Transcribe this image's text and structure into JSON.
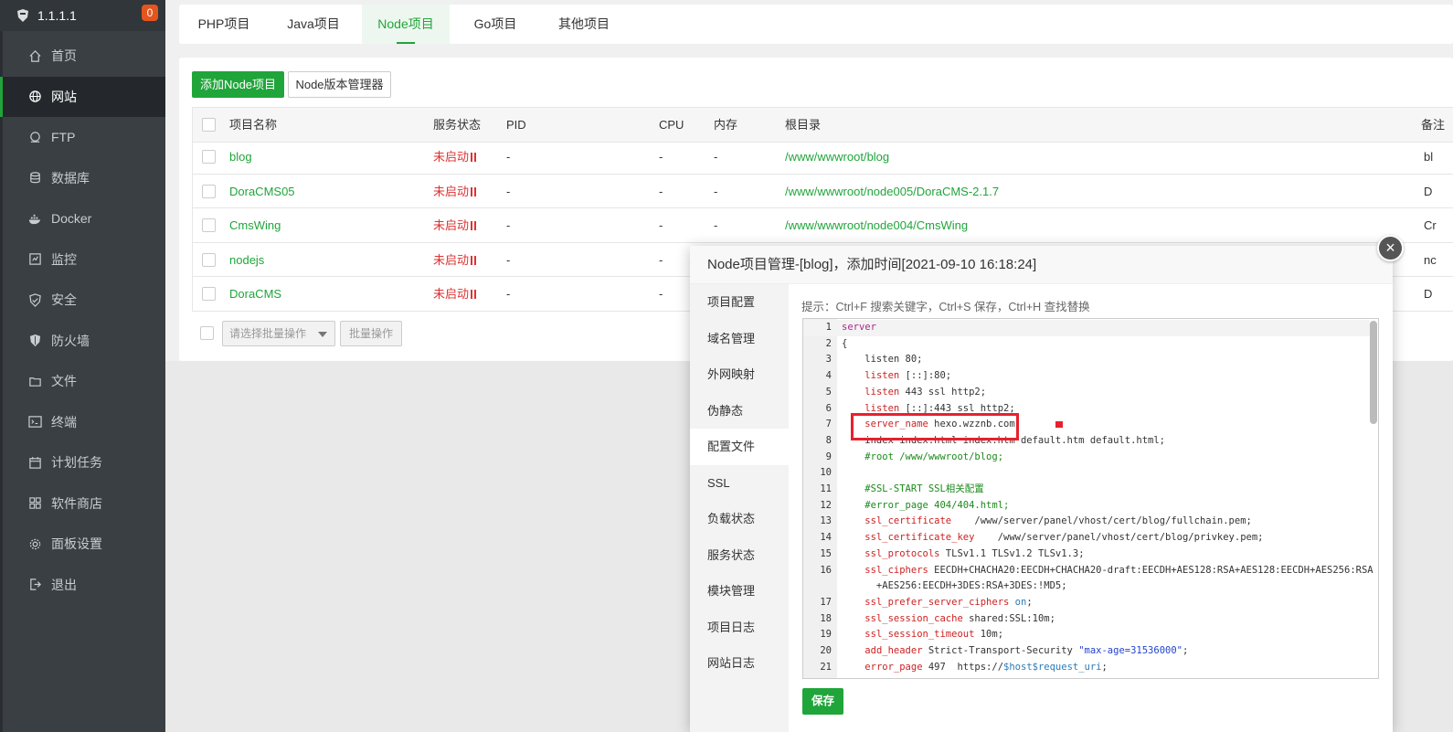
{
  "sidebar": {
    "ip": "1.1.1.1",
    "badge": "0",
    "items": [
      {
        "label": "首页",
        "icon": "home-icon"
      },
      {
        "label": "网站",
        "icon": "globe-icon",
        "active": true
      },
      {
        "label": "FTP",
        "icon": "ftp-icon"
      },
      {
        "label": "数据库",
        "icon": "database-icon"
      },
      {
        "label": "Docker",
        "icon": "docker-icon"
      },
      {
        "label": "监控",
        "icon": "monitor-icon"
      },
      {
        "label": "安全",
        "icon": "shield-check-icon"
      },
      {
        "label": "防火墙",
        "icon": "firewall-icon"
      },
      {
        "label": "文件",
        "icon": "folder-icon"
      },
      {
        "label": "终端",
        "icon": "terminal-icon"
      },
      {
        "label": "计划任务",
        "icon": "calendar-icon"
      },
      {
        "label": "软件商店",
        "icon": "apps-icon"
      },
      {
        "label": "面板设置",
        "icon": "gear-icon"
      },
      {
        "label": "退出",
        "icon": "logout-icon"
      }
    ]
  },
  "tabs": [
    "PHP项目",
    "Java项目",
    "Node项目",
    "Go项目",
    "其他项目"
  ],
  "toolbar": {
    "add_label": "添加Node项目",
    "version_label": "Node版本管理器"
  },
  "table": {
    "headers": [
      "项目名称",
      "服务状态",
      "PID",
      "CPU",
      "内存",
      "根目录",
      "备注"
    ],
    "rows": [
      {
        "name": "blog",
        "status": "未启动",
        "pid": "-",
        "cpu": "-",
        "mem": "-",
        "root": "/www/wwwroot/blog",
        "note": "bl"
      },
      {
        "name": "DoraCMS05",
        "status": "未启动",
        "pid": "-",
        "cpu": "-",
        "mem": "-",
        "root": "/www/wwwroot/node005/DoraCMS-2.1.7",
        "note": "D"
      },
      {
        "name": "CmsWing",
        "status": "未启动",
        "pid": "-",
        "cpu": "-",
        "mem": "-",
        "root": "/www/wwwroot/node004/CmsWing",
        "note": "Cr"
      },
      {
        "name": "nodejs",
        "status": "未启动",
        "pid": "-",
        "cpu": "-",
        "mem": "",
        "root": "",
        "note": "nc"
      },
      {
        "name": "DoraCMS",
        "status": "未启动",
        "pid": "-",
        "cpu": "-",
        "mem": "",
        "root": "",
        "note": "D"
      }
    ]
  },
  "bulk": {
    "select_placeholder": "请选择批量操作",
    "button": "批量操作"
  },
  "modal": {
    "title": "Node项目管理-[blog]，添加时间[2021-09-10 16:18:24]",
    "menu": [
      "项目配置",
      "域名管理",
      "外网映射",
      "伪静态",
      "配置文件",
      "SSL",
      "负载状态",
      "服务状态",
      "模块管理",
      "项目日志",
      "网站日志"
    ],
    "active_menu": "配置文件",
    "hint": "提示：Ctrl+F 搜索关键字，Ctrl+S 保存，Ctrl+H 查找替换",
    "save_label": "保存",
    "close_symbol": "×"
  },
  "code_lines": [
    {
      "n": "1",
      "html": "<span class='kw'>server</span>"
    },
    {
      "n": "2",
      "html": "{"
    },
    {
      "n": "3",
      "html": "    listen 80;"
    },
    {
      "n": "4",
      "html": "    <span class='dir'>listen</span> [::]:80;"
    },
    {
      "n": "5",
      "html": "    <span class='dir'>listen</span> 443 ssl http2;"
    },
    {
      "n": "6",
      "html": "    <span class='dir'>listen</span> [::]:443 ssl http2;"
    },
    {
      "n": "7",
      "html": "    <span class='dir'>server_name</span> hexo.wzznb.com;"
    },
    {
      "n": "8",
      "html": "    index index.html index.htm default.htm default.html;"
    },
    {
      "n": "9",
      "html": "    <span class='cmt'>#root /www/wwwroot/blog;</span>"
    },
    {
      "n": "10",
      "html": ""
    },
    {
      "n": "11",
      "html": "    <span class='cmt'>#SSL-START SSL相关配置</span>"
    },
    {
      "n": "12",
      "html": "    <span class='cmt'>#error_page 404/404.html;</span>"
    },
    {
      "n": "13",
      "html": "    <span class='dir'>ssl_certificate</span>    /www/server/panel/vhost/cert/blog/fullchain.pem;"
    },
    {
      "n": "14",
      "html": "    <span class='dir'>ssl_certificate_key</span>    /www/server/panel/vhost/cert/blog/privkey.pem;"
    },
    {
      "n": "15",
      "html": "    <span class='dir'>ssl_protocols</span> TLSv1.1 TLSv1.2 TLSv1.3;"
    },
    {
      "n": "16",
      "html": "    <span class='dir'>ssl_ciphers</span> EECDH+CHACHA20:EECDH+CHACHA20-draft:EECDH+AES128:RSA+AES128:EECDH+AES256:RSA"
    },
    {
      "n": "",
      "html": "      +AES256:EECDH+3DES:RSA+3DES:!MD5;"
    },
    {
      "n": "17",
      "html": "    <span class='dir'>ssl_prefer_server_ciphers</span> <span class='var'>on</span>;"
    },
    {
      "n": "18",
      "html": "    <span class='dir'>ssl_session_cache</span> shared:SSL:10m;"
    },
    {
      "n": "19",
      "html": "    <span class='dir'>ssl_session_timeout</span> 10m;"
    },
    {
      "n": "20",
      "html": "    <span class='dir'>add_header</span> Strict-Transport-Security <span class='str'>\"max-age=31536000\"</span>;"
    },
    {
      "n": "21",
      "html": "    <span class='dir'>error_page</span> 497  https://<span class='var'>$host$request_uri</span>;"
    }
  ]
}
